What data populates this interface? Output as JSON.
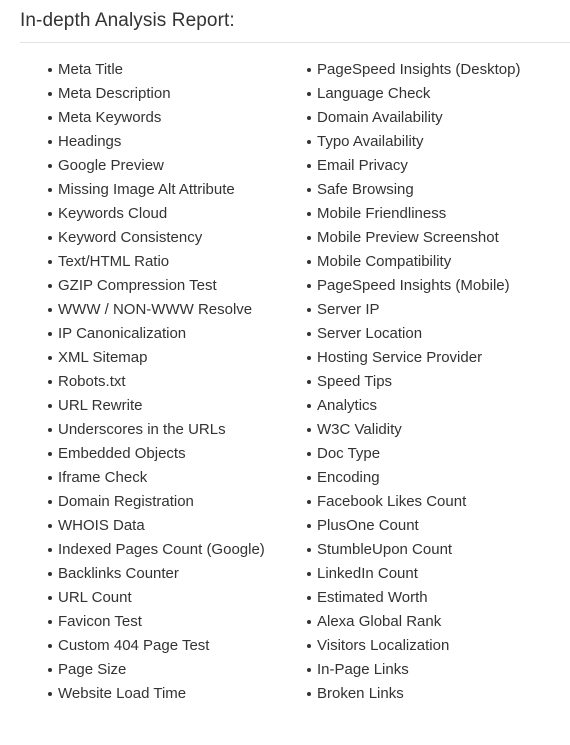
{
  "header": {
    "title": "In-depth Analysis Report:"
  },
  "colors": {
    "background": "#ffffff",
    "text": "#333333",
    "rule": "#e2e2e2",
    "bullet": "#333333"
  },
  "report": {
    "columns": [
      {
        "name": "left-column",
        "items": [
          "Meta Title",
          "Meta Description",
          "Meta Keywords",
          "Headings",
          "Google Preview",
          "Missing Image Alt Attribute",
          "Keywords Cloud",
          "Keyword Consistency",
          "Text/HTML Ratio",
          "GZIP Compression Test",
          "WWW / NON-WWW Resolve",
          "IP Canonicalization",
          "XML Sitemap",
          "Robots.txt",
          "URL Rewrite",
          "Underscores in the URLs",
          "Embedded Objects",
          "Iframe Check",
          "Domain Registration",
          "WHOIS Data",
          "Indexed Pages Count (Google)",
          "Backlinks Counter",
          "URL Count",
          "Favicon Test",
          "Custom 404 Page Test",
          "Page Size",
          "Website Load Time"
        ]
      },
      {
        "name": "right-column",
        "items": [
          "PageSpeed Insights (Desktop)",
          "Language Check",
          "Domain Availability",
          "Typo Availability",
          "Email Privacy",
          "Safe Browsing",
          "Mobile Friendliness",
          "Mobile Preview Screenshot",
          "Mobile Compatibility",
          "PageSpeed Insights (Mobile)",
          "Server IP",
          "Server Location",
          "Hosting Service Provider",
          "Speed Tips",
          "Analytics",
          "W3C Validity",
          "Doc Type",
          "Encoding",
          "Facebook Likes Count",
          "PlusOne Count",
          "StumbleUpon Count",
          "LinkedIn Count",
          "Estimated Worth",
          "Alexa Global Rank",
          "Visitors Localization",
          "In-Page Links",
          "Broken Links"
        ]
      }
    ]
  }
}
